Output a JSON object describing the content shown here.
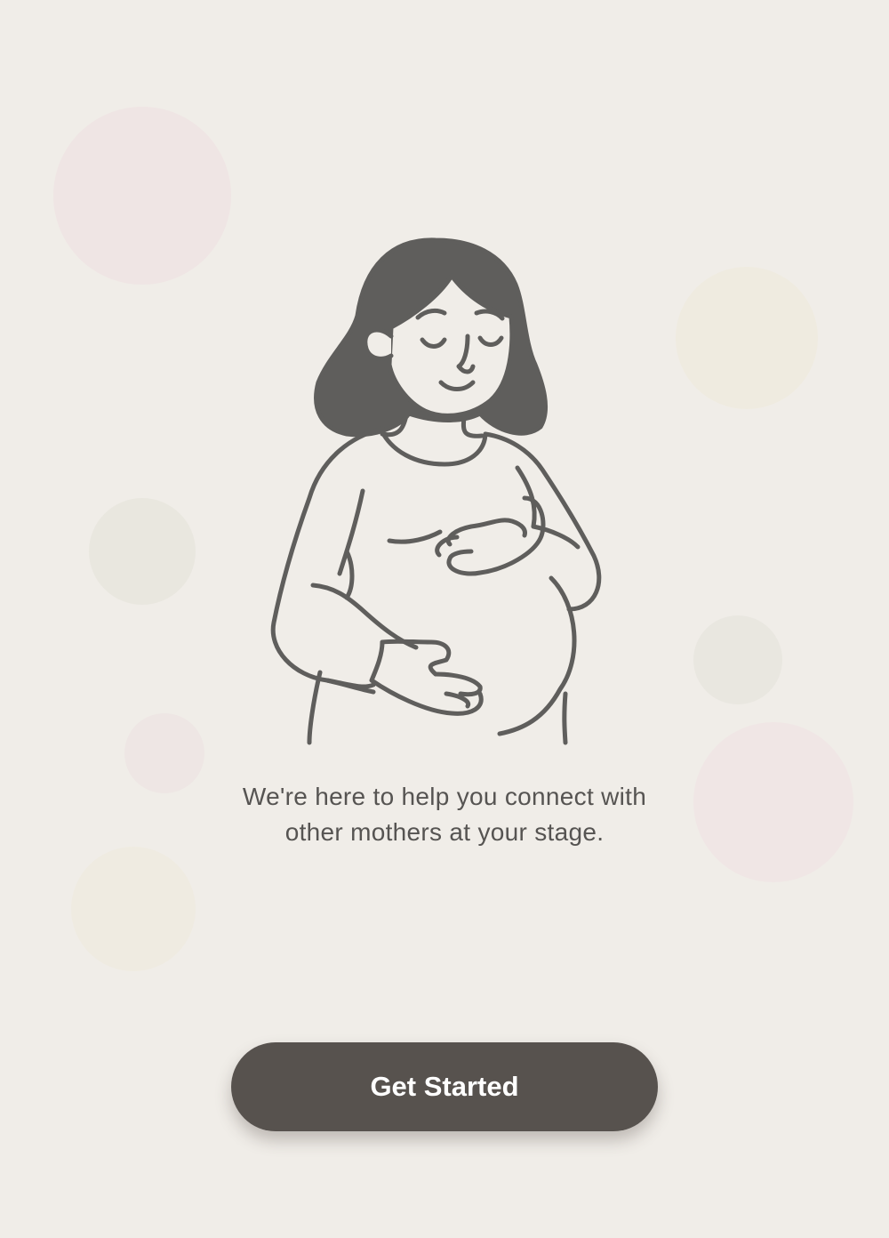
{
  "onboarding": {
    "message": "We're here to help you connect with other mothers at your stage.",
    "illustration_icon": "pregnant-woman-illustration",
    "cta_label": "Get Started"
  },
  "theme": {
    "background": "#f0ede8",
    "button": "#57524e",
    "button_text": "#ffffff",
    "text": "#565452",
    "line_art": "#5f5e5c"
  }
}
